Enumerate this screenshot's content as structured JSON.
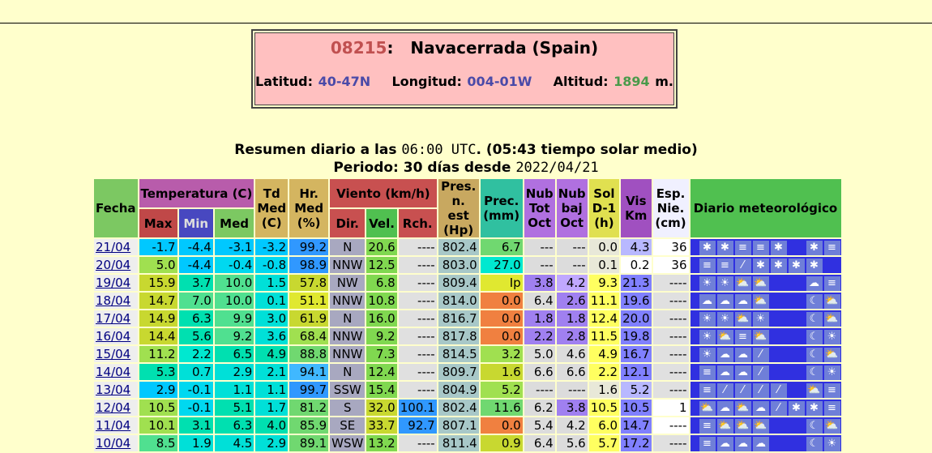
{
  "station": {
    "code": "08215",
    "sep": ":",
    "name": "Navacerrada (Spain)",
    "lat_label": "Latitud:",
    "lat": "40-47N",
    "lon_label": "Longitud:",
    "lon": "004-01W",
    "alt_label": "Altitud:",
    "alt": "1894",
    "alt_unit": "m."
  },
  "summary": {
    "line1_a": "Resumen diario a las",
    "line1_time": "06:00 UTC",
    "line1_b": ". (05:43 tiempo solar medio)",
    "line2_a": "Periodo:",
    "line2_days": "30 días desde",
    "line2_date": "2022/04/21"
  },
  "headers": {
    "fecha": "Fecha",
    "temp": "Temperatura (C)",
    "max": "Max",
    "min": "Min",
    "med": "Med",
    "td": "Td Med (C)",
    "hr": "Hr. Med (%)",
    "viento": "Viento (km/h)",
    "dir": "Dir.",
    "vel": "Vel.",
    "rch": "Rch.",
    "pres": "Pres. n. est (Hp)",
    "prec": "Prec. (mm)",
    "nubtot": "Nub Tot Oct",
    "nubbaj": "Nub baj Oct",
    "sol": "Sol D-1 (h)",
    "vis": "Vis Km",
    "esp": "Esp. Nie. (cm)",
    "diario": "Diario meteorológico"
  },
  "rows": [
    {
      "fecha": "21/04",
      "max": "-1.7",
      "min": "-4.4",
      "med": "-3.1",
      "td": "-3.2",
      "hr": "99.2",
      "dir": "N",
      "vel": "20.6",
      "rch": "----",
      "pres": "802.4",
      "prec": "6.7",
      "nubtot": "---",
      "nubbaj": "---",
      "sol": "0.0",
      "vis": "4.3",
      "esp": "36",
      "wx": [
        "snow",
        "snow",
        "fog",
        "fog",
        "snow",
        "",
        "snow",
        "fog"
      ]
    },
    {
      "fecha": "20/04",
      "max": "5.0",
      "min": "-4.4",
      "med": "-0.4",
      "td": "-0.8",
      "hr": "98.9",
      "dir": "NNW",
      "vel": "12.5",
      "rch": "----",
      "pres": "803.0",
      "prec": "27.0",
      "nubtot": "---",
      "nubbaj": "---",
      "sol": "0.1",
      "vis": "0.2",
      "esp": "36",
      "wx": [
        "fog",
        "fog",
        "rain",
        "snow",
        "snow",
        "snow",
        "snow",
        ""
      ]
    },
    {
      "fecha": "19/04",
      "max": "15.9",
      "min": "3.7",
      "med": "10.0",
      "td": "1.5",
      "hr": "57.8",
      "dir": "NW",
      "vel": "6.8",
      "rch": "----",
      "pres": "809.4",
      "prec": "Ip",
      "nubtot": "3.8",
      "nubbaj": "4.2",
      "sol": "9.3",
      "vis": "21.3",
      "esp": "----",
      "wx": [
        "sun",
        "sun",
        "partly",
        "partly",
        "",
        "",
        "cloud",
        "fog"
      ]
    },
    {
      "fecha": "18/04",
      "max": "14.7",
      "min": "7.0",
      "med": "10.0",
      "td": "0.1",
      "hr": "51.1",
      "dir": "NNW",
      "vel": "10.8",
      "rch": "----",
      "pres": "814.0",
      "prec": "0.0",
      "nubtot": "6.4",
      "nubbaj": "2.6",
      "sol": "11.1",
      "vis": "19.6",
      "esp": "----",
      "wx": [
        "cloud",
        "cloud",
        "cloud",
        "partly",
        "",
        "",
        "moon",
        "partly"
      ]
    },
    {
      "fecha": "17/04",
      "max": "14.9",
      "min": "6.3",
      "med": "9.9",
      "td": "3.0",
      "hr": "61.9",
      "dir": "N",
      "vel": "16.0",
      "rch": "----",
      "pres": "816.7",
      "prec": "0.0",
      "nubtot": "1.8",
      "nubbaj": "1.8",
      "sol": "12.4",
      "vis": "20.0",
      "esp": "----",
      "wx": [
        "sun",
        "sun",
        "partly",
        "sun",
        "",
        "",
        "moon",
        "partly"
      ]
    },
    {
      "fecha": "16/04",
      "max": "14.4",
      "min": "5.6",
      "med": "9.2",
      "td": "3.6",
      "hr": "68.4",
      "dir": "NNW",
      "vel": "9.2",
      "rch": "----",
      "pres": "817.8",
      "prec": "0.0",
      "nubtot": "2.2",
      "nubbaj": "2.8",
      "sol": "11.5",
      "vis": "19.8",
      "esp": "----",
      "wx": [
        "sun",
        "partly",
        "fog",
        "partly",
        "",
        "",
        "moon",
        "sun"
      ]
    },
    {
      "fecha": "15/04",
      "max": "11.2",
      "min": "2.2",
      "med": "6.5",
      "td": "4.9",
      "hr": "88.8",
      "dir": "NNW",
      "vel": "7.3",
      "rch": "----",
      "pres": "814.5",
      "prec": "3.2",
      "nubtot": "5.0",
      "nubbaj": "4.6",
      "sol": "4.9",
      "vis": "16.7",
      "esp": "----",
      "wx": [
        "sun",
        "cloud",
        "cloud",
        "rain",
        "",
        "",
        "moon",
        "partly"
      ]
    },
    {
      "fecha": "14/04",
      "max": "5.3",
      "min": "0.7",
      "med": "2.9",
      "td": "2.1",
      "hr": "94.1",
      "dir": "N",
      "vel": "12.4",
      "rch": "----",
      "pres": "809.7",
      "prec": "1.6",
      "nubtot": "6.6",
      "nubbaj": "6.6",
      "sol": "2.2",
      "vis": "12.1",
      "esp": "----",
      "wx": [
        "fog",
        "cloud",
        "cloud",
        "rain",
        "",
        "",
        "moon",
        "sun"
      ]
    },
    {
      "fecha": "13/04",
      "max": "2.9",
      "min": "-0.1",
      "med": "1.1",
      "td": "1.1",
      "hr": "99.7",
      "dir": "SSW",
      "vel": "15.4",
      "rch": "----",
      "pres": "804.9",
      "prec": "5.2",
      "nubtot": "----",
      "nubbaj": "----",
      "sol": "1.6",
      "vis": "5.2",
      "esp": "----",
      "wx": [
        "fog",
        "rain",
        "rain",
        "rain",
        "rain",
        "",
        "partly",
        "fog"
      ]
    },
    {
      "fecha": "12/04",
      "max": "10.5",
      "min": "-0.1",
      "med": "5.1",
      "td": "1.7",
      "hr": "81.2",
      "dir": "S",
      "vel": "32.0",
      "rch": "100.1",
      "pres": "802.4",
      "prec": "11.6",
      "nubtot": "6.2",
      "nubbaj": "3.8",
      "sol": "10.5",
      "vis": "10.5",
      "esp": "1",
      "wx": [
        "partly",
        "cloud",
        "partly",
        "cloud",
        "rain",
        "snow",
        "snow",
        "fog"
      ]
    },
    {
      "fecha": "11/04",
      "max": "10.1",
      "min": "3.1",
      "med": "6.3",
      "td": "4.0",
      "hr": "85.9",
      "dir": "SE",
      "vel": "33.7",
      "rch": "92.7",
      "pres": "807.1",
      "prec": "0.0",
      "nubtot": "5.4",
      "nubbaj": "4.2",
      "sol": "6.0",
      "vis": "14.7",
      "esp": "----",
      "wx": [
        "fog",
        "partly",
        "partly",
        "partly",
        "",
        "",
        "moon",
        "partly"
      ]
    },
    {
      "fecha": "10/04",
      "max": "8.5",
      "min": "1.9",
      "med": "4.5",
      "td": "2.9",
      "hr": "89.1",
      "dir": "WSW",
      "vel": "13.2",
      "rch": "----",
      "pres": "811.4",
      "prec": "0.9",
      "nubtot": "6.4",
      "nubbaj": "5.6",
      "sol": "5.7",
      "vis": "17.2",
      "esp": "----",
      "wx": [
        "fog",
        "cloud",
        "cloud",
        "cloud",
        "",
        "",
        "moon",
        "sun"
      ]
    }
  ],
  "colors": {
    "max": [
      "#00c8ff",
      "#a0e050",
      "#c8d830",
      "#c8d830",
      "#c8d830",
      "#c8d830",
      "#a0e050",
      "#00e0b0",
      "#00c8ff",
      "#a0e050",
      "#a0e050",
      "#50e090"
    ],
    "min": [
      "#00c8ff",
      "#00c8ff",
      "#00e0b0",
      "#50e090",
      "#00e0b0",
      "#00e0b0",
      "#00e8d0",
      "#00e0d8",
      "#00d8f0",
      "#00d8f0",
      "#00e0b0",
      "#00e0d8"
    ],
    "med": [
      "#00c8ff",
      "#00d8f0",
      "#50e090",
      "#50e090",
      "#50e090",
      "#50e090",
      "#00e0b0",
      "#00e0d8",
      "#00e0d8",
      "#00e0b0",
      "#00e0b0",
      "#00e0d8"
    ],
    "td": [
      "#00c8ff",
      "#00d8f0",
      "#00e0d8",
      "#00e0d8",
      "#00e0d8",
      "#00e0d8",
      "#00e0b0",
      "#00e0d8",
      "#00e0d8",
      "#00e0d8",
      "#00e0b0",
      "#00e0d8"
    ],
    "hr": [
      "#3098ff",
      "#3098ff",
      "#c8d830",
      "#e0e830",
      "#c8d830",
      "#a0e050",
      "#70d870",
      "#40b8ff",
      "#3098ff",
      "#70d870",
      "#70d870",
      "#70d870"
    ],
    "vel": [
      "#80d850",
      "#80d850",
      "#80d850",
      "#80d850",
      "#80d850",
      "#80d850",
      "#80d850",
      "#80d850",
      "#80d850",
      "#c8d830",
      "#c8d830",
      "#80d850"
    ],
    "rch": [
      "#e0e0e0",
      "#e0e0e0",
      "#e0e0e0",
      "#e0e0e0",
      "#e0e0e0",
      "#e0e0e0",
      "#e0e0e0",
      "#e0e0e0",
      "#e0e0e0",
      "#3098ff",
      "#3098ff",
      "#e0e0e0"
    ],
    "prec": [
      "#70d870",
      "#00e8d0",
      "#e0e830",
      "#f08040",
      "#f08040",
      "#f08040",
      "#a0e050",
      "#c8d830",
      "#a0e050",
      "#70d870",
      "#f08040",
      "#c8d830"
    ],
    "nubtot": [
      "#dcdcdc",
      "#dcdcdc",
      "#a080f0",
      "#dcdcdc",
      "#a080f0",
      "#a080f0",
      "#dcdcdc",
      "#dcdcdc",
      "#dcdcdc",
      "#dcdcdc",
      "#dcdcdc",
      "#dcdcdc"
    ],
    "nubbaj": [
      "#dcdcdc",
      "#dcdcdc",
      "#c0a8ff",
      "#a080f0",
      "#a080f0",
      "#a080f0",
      "#dcdcdc",
      "#dcdcdc",
      "#dcdcdc",
      "#a080f0",
      "#dcdcdc",
      "#dcdcdc"
    ],
    "sol": [
      "#e8e8d8",
      "#e8e8d8",
      "#ffff60",
      "#ffff60",
      "#ffff60",
      "#ffff60",
      "#ffff60",
      "#ffff60",
      "#e8e8d8",
      "#ffff60",
      "#ffff60",
      "#ffff60"
    ],
    "vis": [
      "#b8b8ff",
      "#ffffff",
      "#8080ff",
      "#8080ff",
      "#8080ff",
      "#8080ff",
      "#8080ff",
      "#8080ff",
      "#b8b8ff",
      "#8080ff",
      "#8080ff",
      "#8080ff"
    ],
    "esp": [
      "#ffffff",
      "#ffffff",
      "#e0e0e0",
      "#e0e0e0",
      "#e0e0e0",
      "#e0e0e0",
      "#e0e0e0",
      "#e0e0e0",
      "#e0e0e0",
      "#ffffff",
      "#ffffff",
      "#e0e0e0"
    ],
    "dir": "#a8a8c0",
    "pres": "#a8c8c8"
  }
}
